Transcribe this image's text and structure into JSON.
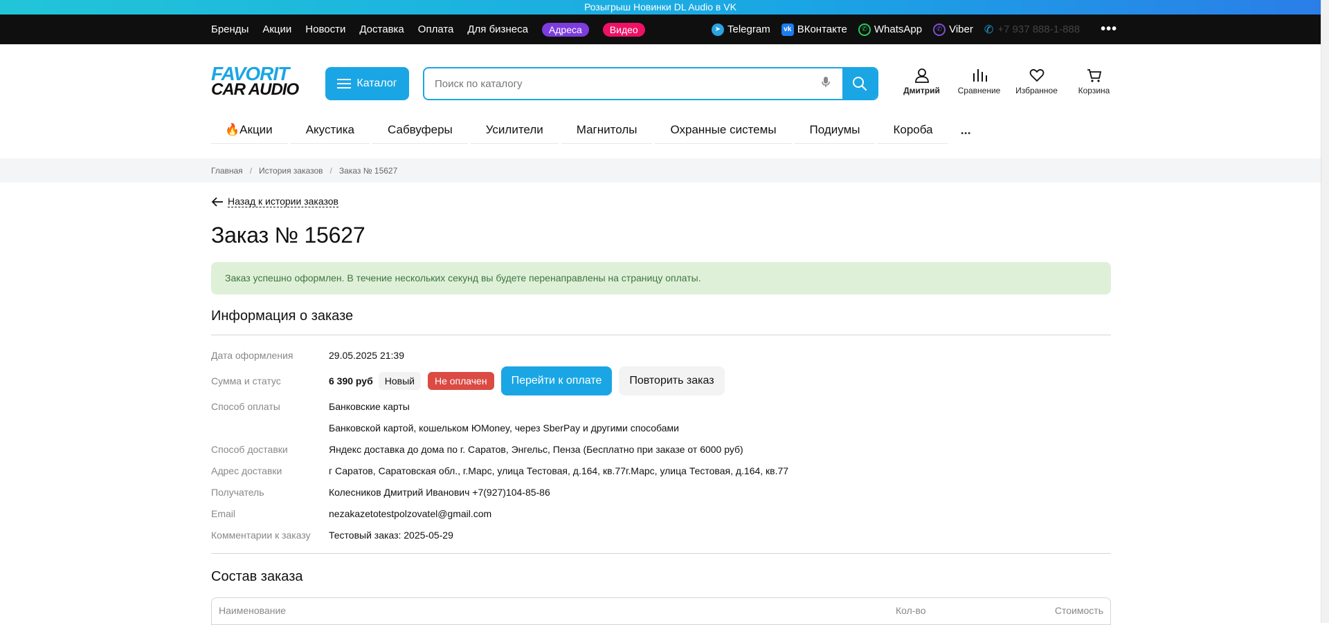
{
  "promo": {
    "text": "Розыгрыш Новинки DL Audio в VK"
  },
  "topbar": {
    "links": [
      "Бренды",
      "Акции",
      "Новости",
      "Доставка",
      "Оплата",
      "Для бизнеса"
    ],
    "pill_addresses": "Адреса",
    "pill_video": "Видео",
    "socials": {
      "telegram": "Telegram",
      "vk": "ВКонтакте",
      "whatsapp": "WhatsApp",
      "viber": "Viber"
    },
    "phone": "+7 937 888-1-888",
    "colors": {
      "bg": "#0f0f0f",
      "pill_addresses": "#7d3cde",
      "pill_video": "#ee1166"
    }
  },
  "header": {
    "logo_line1": "FAVORIT",
    "logo_line2": "CAR AUDIO",
    "catalog_label": "Каталог",
    "search_placeholder": "Поиск по каталогу",
    "user_label": "Дмитрий",
    "compare_label": "Сравнение",
    "favorites_label": "Избранное",
    "cart_label": "Корзина",
    "accent": "#1aa6e4"
  },
  "nav": {
    "items": [
      "🔥Акции",
      "Акустика",
      "Сабвуферы",
      "Усилители",
      "Магнитолы",
      "Охранные системы",
      "Подиумы",
      "Короба"
    ],
    "more": "..."
  },
  "breadcrumb": {
    "home": "Главная",
    "history": "История заказов",
    "current": "Заказ № 15627"
  },
  "order": {
    "back_label": "Назад к истории заказов",
    "title": "Заказ № 15627",
    "alert": "Заказ успешно оформлен. В течение нескольких секунд вы будете перенаправлены на страницу оплаты.",
    "info_heading": "Информация о заказе",
    "date_label": "Дата оформления",
    "date_value": "29.05.2025 21:39",
    "sum_label": "Сумма и статус",
    "sum_value": "6 390 руб",
    "status_new": "Новый",
    "status_unpaid": "Не оплачен",
    "pay_button": "Перейти к оплате",
    "repeat_button": "Повторить заказ",
    "payment_label": "Способ оплаты",
    "payment_value": "Банковские карты",
    "payment_note": "Банковской картой, кошельком ЮMoney, через SberPay и другими способами",
    "delivery_label": "Способ доставки",
    "delivery_value": "Яндекс доставка до дома по г. Саратов, Энгельс, Пенза (Бесплатно при заказе от 6000 руб)",
    "address_label": "Адрес доставки",
    "address_value": "г Саратов, Саратовская обл., г.Марс, улица Тестовая, д.164, кв.77г.Марс, улица Тестовая, д.164, кв.77",
    "recipient_label": "Получатель",
    "recipient_value": "Колесников Дмитрий Иванович +7(927)104-85-86",
    "email_label": "Email",
    "email_value": "nezakazetotestpolzovatel@gmail.com",
    "comment_label": "Комментарии к заказу",
    "comment_value": "Тестовый заказ: 2025-05-29",
    "composition_heading": "Состав заказа",
    "table_headers": [
      "Наименование",
      "Кол-во",
      "Стоимость"
    ]
  }
}
